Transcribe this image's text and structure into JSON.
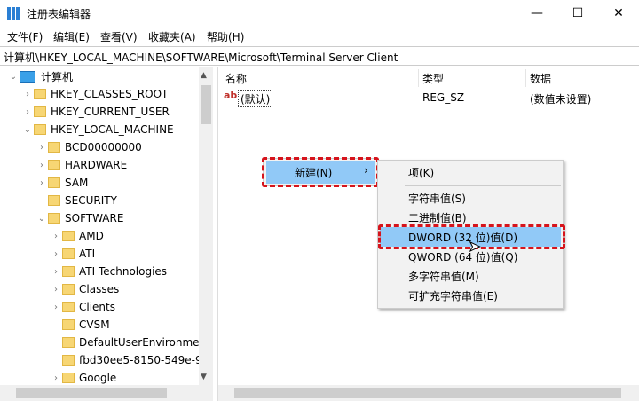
{
  "window": {
    "title": "注册表编辑器",
    "minimize": "—",
    "maximize": "☐",
    "close": "✕"
  },
  "menu": [
    "文件(F)",
    "编辑(E)",
    "查看(V)",
    "收藏夹(A)",
    "帮助(H)"
  ],
  "address": "计算机\\HKEY_LOCAL_MACHINE\\SOFTWARE\\Microsoft\\Terminal Server Client",
  "tree": [
    {
      "label": "计算机",
      "level": 0,
      "chev": "⌄",
      "computer": true
    },
    {
      "label": "HKEY_CLASSES_ROOT",
      "level": 1,
      "chev": "›"
    },
    {
      "label": "HKEY_CURRENT_USER",
      "level": 1,
      "chev": "›"
    },
    {
      "label": "HKEY_LOCAL_MACHINE",
      "level": 1,
      "chev": "⌄"
    },
    {
      "label": "BCD00000000",
      "level": 2,
      "chev": "›"
    },
    {
      "label": "HARDWARE",
      "level": 2,
      "chev": "›"
    },
    {
      "label": "SAM",
      "level": 2,
      "chev": "›"
    },
    {
      "label": "SECURITY",
      "level": 2,
      "chev": ""
    },
    {
      "label": "SOFTWARE",
      "level": 2,
      "chev": "⌄"
    },
    {
      "label": "AMD",
      "level": 3,
      "chev": "›"
    },
    {
      "label": "ATI",
      "level": 3,
      "chev": "›"
    },
    {
      "label": "ATI Technologies",
      "level": 3,
      "chev": "›"
    },
    {
      "label": "Classes",
      "level": 3,
      "chev": "›"
    },
    {
      "label": "Clients",
      "level": 3,
      "chev": "›"
    },
    {
      "label": "CVSM",
      "level": 3,
      "chev": ""
    },
    {
      "label": "DefaultUserEnvironment",
      "level": 3,
      "chev": ""
    },
    {
      "label": "fbd30ee5-8150-549e-9",
      "level": 3,
      "chev": ""
    },
    {
      "label": "Google",
      "level": 3,
      "chev": "›"
    }
  ],
  "columns": {
    "name": "名称",
    "type": "类型",
    "data": "数据"
  },
  "values": [
    {
      "icon": "ab",
      "name": "(默认)",
      "type": "REG_SZ",
      "data": "(数值未设置)"
    }
  ],
  "context_menu": {
    "new": "新建(N)",
    "arrow": "›"
  },
  "submenu": [
    "项(K)",
    "字符串值(S)",
    "二进制值(B)",
    "DWORD (32 位)值(D)",
    "QWORD (64 位)值(Q)",
    "多字符串值(M)",
    "可扩充字符串值(E)"
  ]
}
